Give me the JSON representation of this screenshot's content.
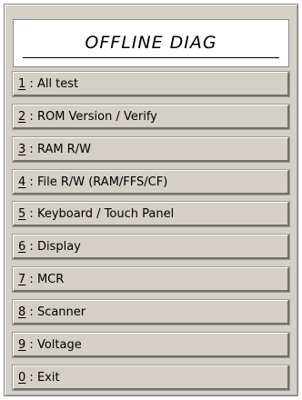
{
  "window": {
    "title": "OFFLINE DIAG"
  },
  "menu": {
    "items": [
      {
        "key": "1",
        "separator": " : ",
        "label": "All test"
      },
      {
        "key": "2",
        "separator": " : ",
        "label": "ROM Version / Verify"
      },
      {
        "key": "3",
        "separator": " : ",
        "label": "RAM R/W"
      },
      {
        "key": "4",
        "separator": " : ",
        "label": "File R/W (RAM/FFS/CF)"
      },
      {
        "key": "5",
        "separator": " : ",
        "label": "Keyboard / Touch Panel"
      },
      {
        "key": "6",
        "separator": " : ",
        "label": "Display"
      },
      {
        "key": "7",
        "separator": " : ",
        "label": "MCR"
      },
      {
        "key": "8",
        "separator": " : ",
        "label": "Scanner"
      },
      {
        "key": "9",
        "separator": " : ",
        "label": "Voltage"
      },
      {
        "key": "0",
        "separator": " : ",
        "label": "Exit"
      }
    ]
  }
}
